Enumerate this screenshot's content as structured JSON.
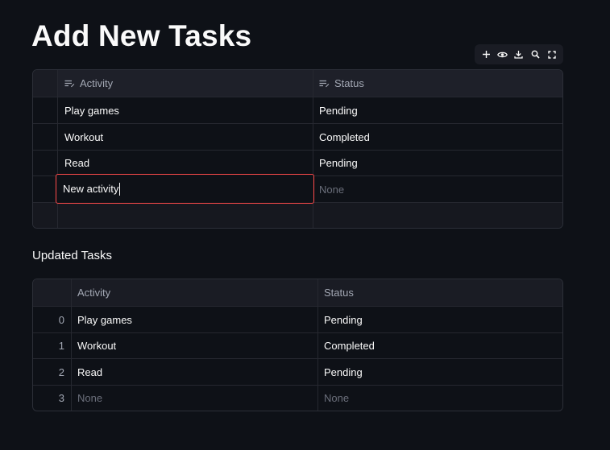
{
  "page": {
    "title": "Add New Tasks",
    "subheading": "Updated Tasks"
  },
  "toolbar": {
    "buttons": [
      {
        "name": "add-row",
        "icon": "plus-icon"
      },
      {
        "name": "toggle-visibility",
        "icon": "eye-icon"
      },
      {
        "name": "download",
        "icon": "download-icon"
      },
      {
        "name": "search",
        "icon": "search-icon"
      },
      {
        "name": "fullscreen",
        "icon": "fullscreen-icon"
      }
    ]
  },
  "editor": {
    "columns": [
      "Activity",
      "Status"
    ],
    "rows": [
      {
        "activity": "Play games",
        "status": "Pending"
      },
      {
        "activity": "Workout",
        "status": "Completed"
      },
      {
        "activity": "Read",
        "status": "Pending"
      }
    ],
    "editing_row": {
      "activity": "New activity",
      "status": "None"
    }
  },
  "result": {
    "columns": [
      "Activity",
      "Status"
    ],
    "rows": [
      {
        "index": "0",
        "activity": "Play games",
        "status": "Pending"
      },
      {
        "index": "1",
        "activity": "Workout",
        "status": "Completed"
      },
      {
        "index": "2",
        "activity": "Read",
        "status": "Pending"
      },
      {
        "index": "3",
        "activity": "None",
        "status": "None"
      }
    ]
  },
  "colors": {
    "background": "#0e1117",
    "accent": "#ff4b4b",
    "border": "#262830",
    "header": "#1a1c24"
  }
}
